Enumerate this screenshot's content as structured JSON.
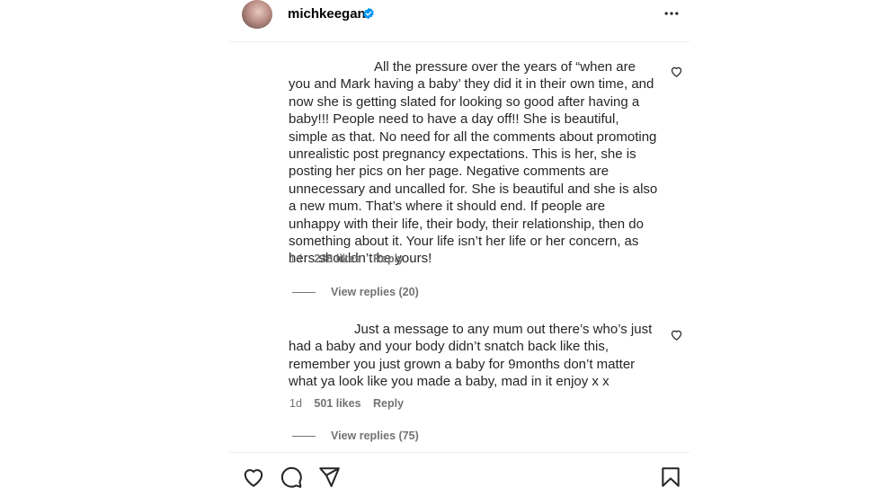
{
  "post": {
    "username": "michkeegan"
  },
  "comments": [
    {
      "text": "All the pressure over the years of “when are you and Mark having a baby’ they did it in their own time, and now she is getting slated for looking so good after having a baby!!! People need to have a day off!! She is beautiful, simple as that. No need for all the comments about promoting unrealistic post pregnancy expectations. This is her, she is posting her pics on her page. Negative comments are unnecessary and uncalled for. She is beautiful and she is also a new mum. That’s where it should end. If people are unhappy with their life, their body, their relationship, then do something about it. Your life isn’t her life or her concern, as hers shouldn’t be yours!",
      "time": "1d",
      "likes": "238 likes",
      "reply": "Reply",
      "view_replies": "View replies (20)"
    },
    {
      "text": "Just a message to any mum out there’s who’s just had a baby and your body didn’t snatch back like this, remember you just grown a baby for 9months don’t matter what ya look like you made a baby, mad in it enjoy x x",
      "time": "1d",
      "likes": "501 likes",
      "reply": "Reply",
      "view_replies": "View replies (75)"
    }
  ],
  "icons": {
    "verified": "verified-badge-icon",
    "more": "more-options-icon",
    "like": "heart-icon",
    "comment": "comment-icon",
    "share": "send-icon",
    "save": "bookmark-icon"
  },
  "colors": {
    "verified": "#0095f6",
    "meta": "#737373",
    "text": "#262626"
  }
}
